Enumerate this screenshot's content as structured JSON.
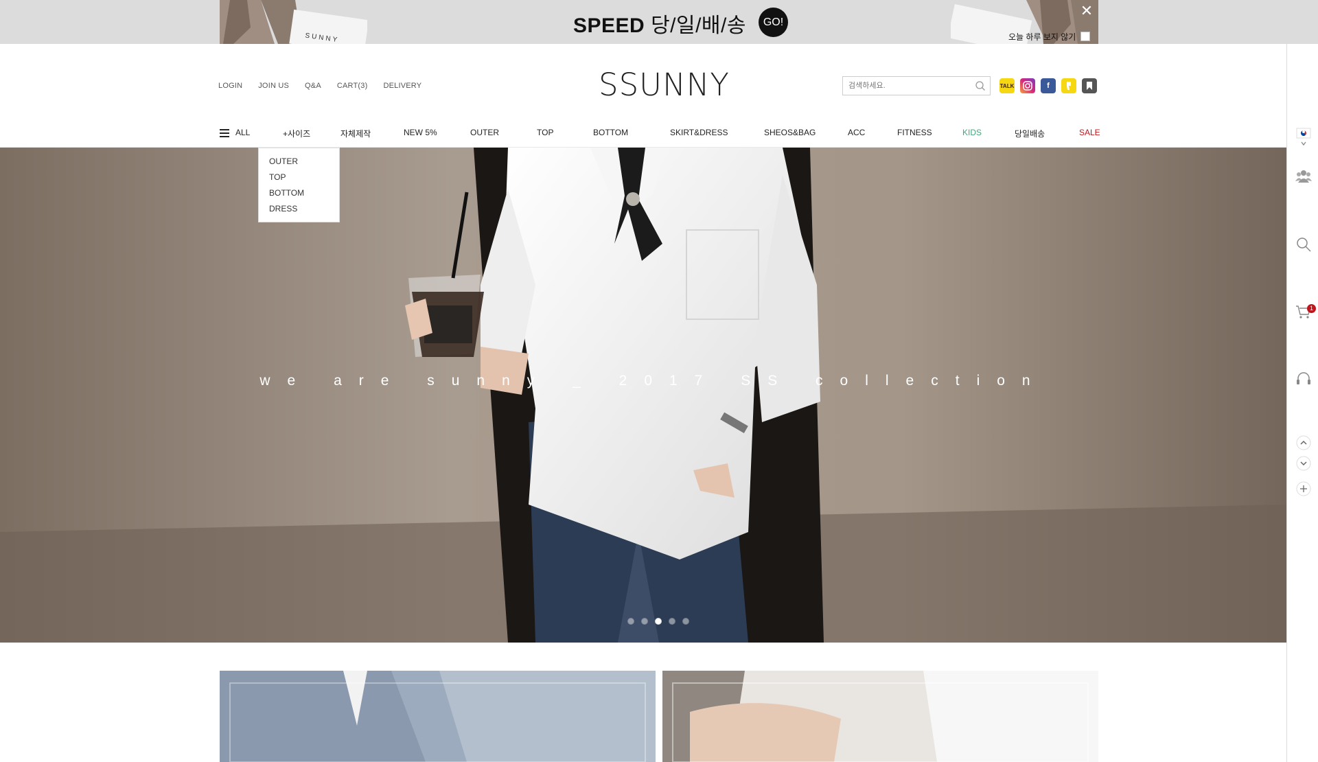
{
  "promo": {
    "title_en": "SPEED",
    "title_kr": "당/일/배/송",
    "go_label": "GO!",
    "close_label": "✕",
    "today_label": "오늘 하루 보지 않기"
  },
  "header": {
    "logo": "SSUNNY",
    "util_links": [
      "LOGIN",
      "JOIN US",
      "Q&A",
      "CART(3)",
      "DELIVERY"
    ],
    "search_placeholder": "검색하세요.",
    "sns": [
      "kakaotalk-icon",
      "instagram-icon",
      "facebook-icon",
      "kakaostory-icon",
      "bookmark-icon"
    ]
  },
  "nav": {
    "items": [
      "ALL",
      "+사이즈",
      "자체제작",
      "NEW 5%",
      "OUTER",
      "TOP",
      "BOTTOM",
      "SKIRT&DRESS",
      "SHEOS&BAG",
      "ACC",
      "FITNESS",
      "KIDS",
      "당일배송",
      "SALE"
    ],
    "kids_color": "#3fa87e",
    "sale_color": "#c0151c"
  },
  "dropdown": {
    "items": [
      "OUTER",
      "TOP",
      "BOTTOM",
      "DRESS"
    ]
  },
  "hero": {
    "caption": "we are sunny _ 2017 SS collection",
    "slide_count": 5,
    "active_slide": 3
  },
  "quickbar": {
    "icons": [
      "korea-flag-icon",
      "community-icon",
      "search-icon",
      "cart-icon",
      "customer-service-icon",
      "scroll-up-icon",
      "scroll-down-icon",
      "plus-icon"
    ],
    "cart_badge": "1"
  }
}
